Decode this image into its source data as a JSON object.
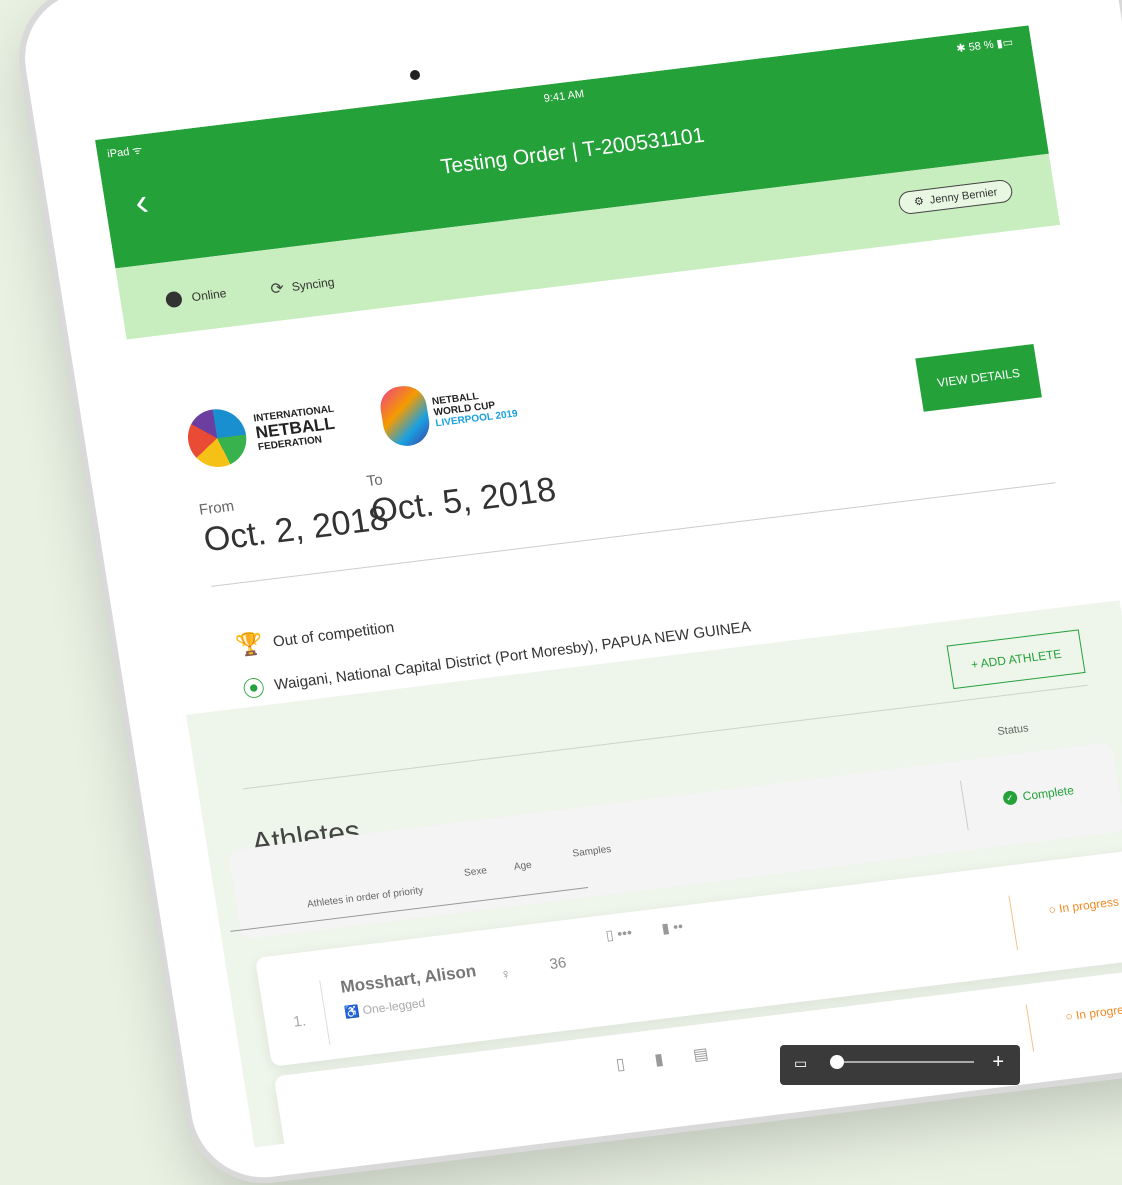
{
  "status_bar": {
    "left": "iPad ᯤ",
    "time": "9:41 AM",
    "right": "✱ 58 % ▮▭"
  },
  "header": {
    "back_glyph": "‹",
    "title": "Testing Order  |  T-200531101"
  },
  "sync_bar": {
    "online": "Online",
    "syncing": "Syncing",
    "user": "Jenny Bernier",
    "sync_icon": "⟳",
    "user_icon": "⚙"
  },
  "logos": {
    "federation": {
      "line1": "INTERNATIONAL",
      "line2": "NETBALL",
      "line3": "FEDERATION"
    },
    "worldcup": {
      "line1": "NETBALL",
      "line2": "WORLD CUP",
      "line3": "LIVERPOOL 2019"
    }
  },
  "order": {
    "view_details": "VIEW DETAILS",
    "from_label": "From",
    "from_value": "Oct. 2, 2018",
    "to_label": "To",
    "to_value": "Oct. 5, 2018",
    "competition_icon": "🏆",
    "competition": "Out of competition",
    "location_icon": "⦿",
    "location": "Waigani, National Capital District (Port Moresby), PAPUA NEW GUINEA"
  },
  "athletes": {
    "add_button": "+ ADD ATHLETE",
    "title": "Athletes",
    "status_header": "Status",
    "columns": {
      "name": "Athletes in order of priority",
      "sex": "Sexe",
      "age": "Age",
      "samples": "Samples"
    },
    "header_status": "Complete",
    "rows": [
      {
        "num": "1.",
        "name": "Mosshart, Alison",
        "sub": "♿ One-legged",
        "sex": "♀",
        "age": "36",
        "samples": [
          "▯ •••",
          "▮ ••"
        ],
        "status": "○ In progress"
      }
    ],
    "row2_icons": [
      "▯",
      "▮",
      "▤"
    ],
    "row2_status": "○ In progress"
  },
  "toolbar": {
    "icon": "▭",
    "plus": "+"
  }
}
